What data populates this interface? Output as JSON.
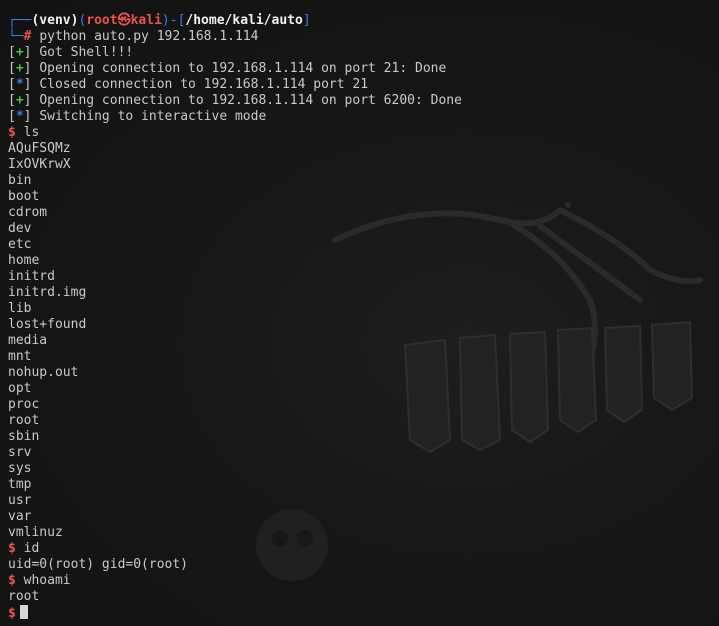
{
  "prompt": {
    "corner_top": "┌──",
    "venv": "(venv)",
    "paren_open": "(",
    "user": "root",
    "at": "㉿",
    "host": "kali",
    "paren_close": ")",
    "dash": "-[",
    "path": "/home/kali/auto",
    "bracket_close": "]",
    "corner_bottom": "└─",
    "hash": "#",
    "command": "python auto.py 192.168.1.114"
  },
  "log": [
    {
      "sym": "+",
      "text": "Got Shell!!!"
    },
    {
      "sym": "+",
      "text": "Opening connection to 192.168.1.114 on port 21: Done"
    },
    {
      "sym": "*",
      "text": "Closed connection to 192.168.1.114 port 21"
    },
    {
      "sym": "+",
      "text": "Opening connection to 192.168.1.114 on port 6200: Done"
    },
    {
      "sym": "*",
      "text": "Switching to interactive mode"
    }
  ],
  "shell": {
    "dollar": "$",
    "cmd_ls": "ls",
    "ls_output": [
      "AQuFSQMz",
      "IxOVKrwX",
      "bin",
      "boot",
      "cdrom",
      "dev",
      "etc",
      "home",
      "initrd",
      "initrd.img",
      "lib",
      "lost+found",
      "media",
      "mnt",
      "nohup.out",
      "opt",
      "proc",
      "root",
      "sbin",
      "srv",
      "sys",
      "tmp",
      "usr",
      "var",
      "vmlinuz"
    ],
    "cmd_id": "id",
    "id_output": "uid=0(root) gid=0(root)",
    "cmd_whoami": "whoami",
    "whoami_output": "root"
  },
  "colors": {
    "background": "#141414",
    "prompt_blue": "#3d7ae0",
    "prompt_red": "#e8534e",
    "status_green": "#3fc93f",
    "text": "#c9c9c9"
  }
}
